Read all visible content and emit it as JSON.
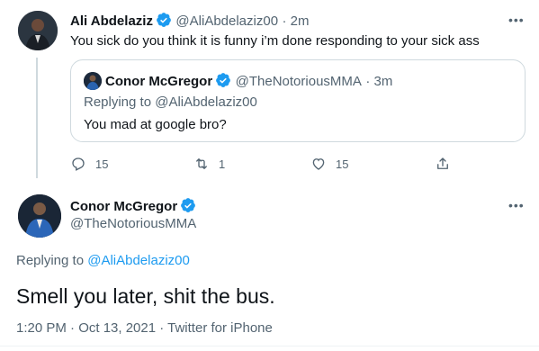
{
  "colors": {
    "accent": "#1d9bf0",
    "muted": "#536471",
    "text": "#0f1419",
    "border": "#cfd9de"
  },
  "parent_tweet": {
    "name": "Ali Abdelaziz",
    "handle": "@AliAbdelaziz00",
    "time": "· 2m",
    "text": "You sick do you think it is funny i’m done responding  to your sick ass",
    "quoted": {
      "name": "Conor McGregor",
      "handle": "@TheNotoriousMMA",
      "time": "· 3m",
      "replying_label": "Replying to",
      "replying_handle": "@AliAbdelaziz00",
      "text": "You mad at google bro?"
    },
    "actions": {
      "replies": "15",
      "retweets": "1",
      "likes": "15"
    }
  },
  "main_tweet": {
    "name": "Conor McGregor",
    "handle": "@TheNotoriousMMA",
    "replying_label": "Replying to",
    "replying_handle": "@AliAbdelaziz00",
    "text": "Smell you later, shit the bus.",
    "meta": "1:20 PM · Oct 13, 2021 · Twitter for iPhone"
  },
  "icons": [
    "verified-icon",
    "more-icon",
    "reply-icon",
    "retweet-icon",
    "like-icon",
    "share-icon"
  ]
}
